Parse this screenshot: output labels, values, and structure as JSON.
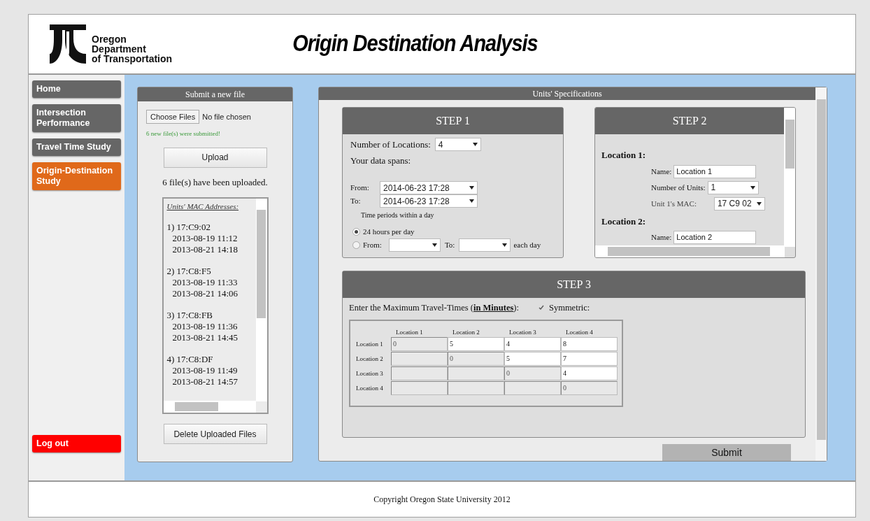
{
  "header": {
    "org_lines": [
      "Oregon",
      "Department",
      "of Transportation"
    ],
    "title": "Origin Destination Analysis"
  },
  "sidebar": {
    "items": [
      {
        "label": "Home",
        "selected": false
      },
      {
        "label": "Intersection Performance",
        "selected": false
      },
      {
        "label": "Travel Time Study",
        "selected": false
      },
      {
        "label": "Origin-Destination Study",
        "selected": true
      }
    ],
    "logout": "Log out"
  },
  "upload_panel": {
    "title": "Submit a new file",
    "file_button": "Choose Files",
    "file_status": "No file chosen",
    "message": "6 new file(s) were submitted!",
    "upload_button": "Upload",
    "uploaded_count": "6 file(s) have been uploaded.",
    "mac_list": {
      "heading": "Units' MAC Addresses:",
      "units": [
        {
          "label": "1) 17:C9:02",
          "times": [
            "2013-08-19 11:12",
            "2013-08-21 14:18"
          ]
        },
        {
          "label": "2) 17:C8:F5",
          "times": [
            "2013-08-19 11:33",
            "2013-08-21 14:06"
          ]
        },
        {
          "label": "3) 17:C8:FB",
          "times": [
            "2013-08-19 11:36",
            "2013-08-21 14:45"
          ]
        },
        {
          "label": "4) 17:C8:DF",
          "times": [
            "2013-08-19 11:49",
            "2013-08-21 14:57"
          ]
        }
      ]
    },
    "delete_button": "Delete Uploaded Files"
  },
  "units_panel": {
    "title": "Units' Specifications",
    "step1": {
      "title": "STEP 1",
      "locations_label": "Number of Locations:",
      "locations_value": "4",
      "spans_label": "Your data spans:",
      "from_label": "From:",
      "from_value": "2014-06-23 17:28",
      "to_label": "To:",
      "to_value": "2014-06-23 17:28",
      "periods_label": "Time periods within a day",
      "options": [
        {
          "kind": "text",
          "label": "24 hours per day",
          "selected": true
        },
        {
          "kind": "range",
          "from_label": "From:",
          "to_label": "To:",
          "suffix": "each day",
          "selected": false
        }
      ]
    },
    "step2": {
      "title": "STEP 2",
      "locations": [
        {
          "label": "Location 1:",
          "name_label": "Name:",
          "name_value": "Location 1",
          "units_label": "Number of Units:",
          "units_value": "1",
          "mac_label": "Unit 1's MAC:",
          "mac_value": "17 C9 02"
        },
        {
          "label": "Location 2:",
          "name_label": "Name:",
          "name_value": "Location 2"
        }
      ]
    },
    "step3": {
      "title": "STEP 3",
      "prompt": "Enter the Maximum Travel-Times (**in Minutes**):",
      "symmetric": {
        "label": "Symmetric:",
        "checked": true
      },
      "matrix": {
        "columns": [
          "Location 1",
          "Location 2",
          "Location 3",
          "Location 4"
        ],
        "rows": [
          {
            "label": "Location 1",
            "cells": [
              {
                "value": "0",
                "disabled": true
              },
              {
                "value": "5",
                "disabled": false
              },
              {
                "value": "4",
                "disabled": false
              },
              {
                "value": "8",
                "disabled": false
              }
            ]
          },
          {
            "label": "Location 2",
            "cells": [
              {
                "disabled": true
              },
              {
                "value": "0",
                "disabled": true
              },
              {
                "value": "5",
                "disabled": false
              },
              {
                "value": "7",
                "disabled": false
              }
            ]
          },
          {
            "label": "Location 3",
            "cells": [
              {
                "disabled": true
              },
              {
                "disabled": true
              },
              {
                "value": "0",
                "disabled": true
              },
              {
                "value": "4",
                "disabled": false
              }
            ]
          },
          {
            "label": "Location 4",
            "cells": [
              {
                "disabled": true
              },
              {
                "disabled": true
              },
              {
                "disabled": true
              },
              {
                "value": "0",
                "disabled": true
              }
            ]
          }
        ]
      }
    },
    "submit_button": "Submit"
  },
  "footer": {
    "copyright": "Copyright Oregon State University 2012"
  }
}
